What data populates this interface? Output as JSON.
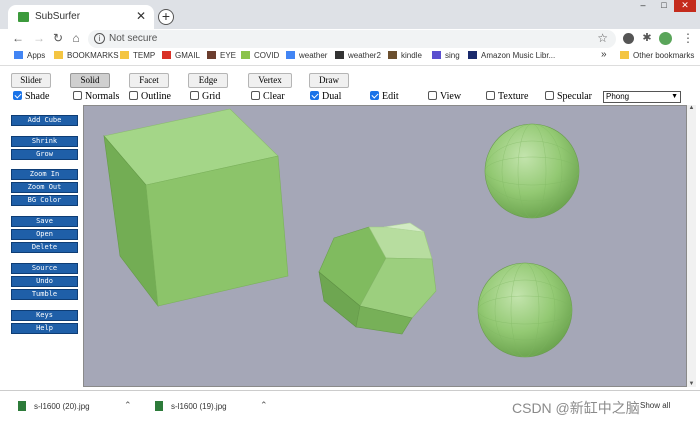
{
  "browser": {
    "tab_title": "SubSurfer",
    "address": "Not secure",
    "window_controls": [
      "–",
      "□",
      "✕"
    ],
    "bookmarks": [
      {
        "label": "Apps",
        "icon": "apps-grid-icon",
        "color": "#4285f4"
      },
      {
        "label": "BOOKMARKS",
        "icon": "folder-icon",
        "color": "#f4c542"
      },
      {
        "label": "TEMP",
        "icon": "folder-icon",
        "color": "#f4c542"
      },
      {
        "label": "GMAIL",
        "icon": "gmail-icon",
        "color": "#d93025"
      },
      {
        "label": "EYE",
        "icon": "eye-thumbnail-icon",
        "color": "#6b3d2e"
      },
      {
        "label": "COVID",
        "icon": "covid-icon",
        "color": "#8bc34a"
      },
      {
        "label": "weather",
        "icon": "google-icon",
        "color": "#4285f4"
      },
      {
        "label": "weather2",
        "icon": "weather-icon",
        "color": "#333333"
      },
      {
        "label": "kindle",
        "icon": "kindle-icon",
        "color": "#6b4f2e"
      },
      {
        "label": "sing",
        "icon": "music-icon",
        "color": "#5a4fcf"
      },
      {
        "label": "Amazon Music Libr...",
        "icon": "amazon-music-icon",
        "color": "#1a2a6c"
      }
    ],
    "overflow_label": "»",
    "other_bookmarks": "Other bookmarks"
  },
  "app": {
    "mode_buttons": [
      "Slider",
      "Solid",
      "Facet",
      "Edge",
      "Vertex",
      "Draw"
    ],
    "active_mode": "Solid",
    "options": [
      {
        "label": "Shade",
        "checked": true
      },
      {
        "label": "Normals",
        "checked": false
      },
      {
        "label": "Outline",
        "checked": false
      },
      {
        "label": "Grid",
        "checked": false
      },
      {
        "label": "Clear",
        "checked": false
      },
      {
        "label": "Dual",
        "checked": true
      },
      {
        "label": "Edit",
        "checked": true
      },
      {
        "label": "View",
        "checked": false
      },
      {
        "label": "Texture",
        "checked": false
      },
      {
        "label": "Specular",
        "checked": false
      }
    ],
    "shading_select": "Phong",
    "side_groups": [
      [
        "Add Cube"
      ],
      [
        "Shrink",
        "Grow"
      ],
      [
        "Zoom In",
        "Zoom Out",
        "BG Color"
      ],
      [
        "Save",
        "Open",
        "Delete"
      ],
      [
        "Source",
        "Undo",
        "Tumble"
      ],
      [
        "Keys",
        "Help"
      ]
    ],
    "canvas_bg": "#a5a7b7",
    "shape_color": "#8cc46a"
  },
  "downloads": {
    "items": [
      "s-l1600 (20).jpg",
      "s-l1600 (19).jpg"
    ],
    "show_all": "Show all"
  },
  "watermark": "CSDN @新缸中之脑"
}
